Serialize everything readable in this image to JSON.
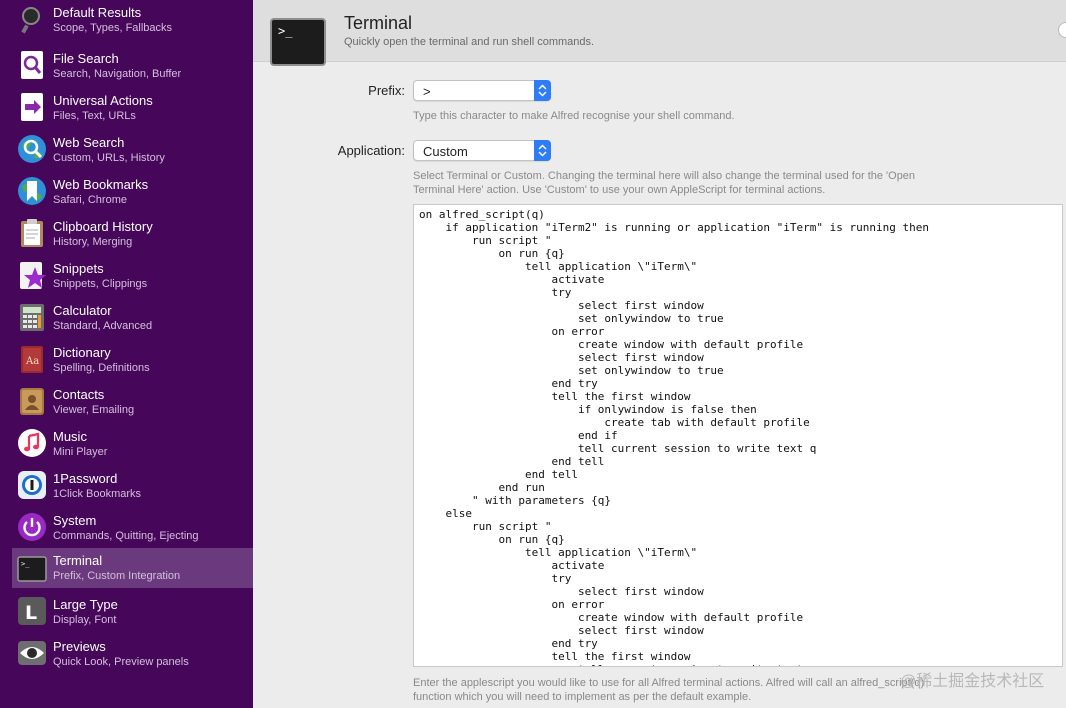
{
  "sidebar": {
    "items": [
      {
        "title": "Default Results",
        "subtitle": "Scope, Types, Fallbacks",
        "icon": "magnifier-default-icon",
        "selected": false
      },
      {
        "title": "File Search",
        "subtitle": "Search, Navigation, Buffer",
        "icon": "file-search-icon",
        "selected": false
      },
      {
        "title": "Universal Actions",
        "subtitle": "Files, Text, URLs",
        "icon": "universal-actions-icon",
        "selected": false
      },
      {
        "title": "Web Search",
        "subtitle": "Custom, URLs, History",
        "icon": "web-search-globe-icon",
        "selected": false
      },
      {
        "title": "Web Bookmarks",
        "subtitle": "Safari, Chrome",
        "icon": "bookmark-globe-icon",
        "selected": false
      },
      {
        "title": "Clipboard History",
        "subtitle": "History, Merging",
        "icon": "clipboard-icon",
        "selected": false
      },
      {
        "title": "Snippets",
        "subtitle": "Snippets, Clippings",
        "icon": "snippets-star-icon",
        "selected": false
      },
      {
        "title": "Calculator",
        "subtitle": "Standard, Advanced",
        "icon": "calculator-icon",
        "selected": false
      },
      {
        "title": "Dictionary",
        "subtitle": "Spelling, Definitions",
        "icon": "dictionary-icon",
        "selected": false
      },
      {
        "title": "Contacts",
        "subtitle": "Viewer, Emailing",
        "icon": "contacts-icon",
        "selected": false
      },
      {
        "title": "Music",
        "subtitle": "Mini Player",
        "icon": "music-note-icon",
        "selected": false
      },
      {
        "title": "1Password",
        "subtitle": "1Click Bookmarks",
        "icon": "onepassword-icon",
        "selected": false
      },
      {
        "title": "System",
        "subtitle": "Commands, Quitting, Ejecting",
        "icon": "power-icon",
        "selected": false
      },
      {
        "title": "Terminal",
        "subtitle": "Prefix, Custom Integration",
        "icon": "terminal-icon",
        "selected": true
      },
      {
        "title": "Large Type",
        "subtitle": "Display, Font",
        "icon": "large-type-icon",
        "selected": false
      },
      {
        "title": "Previews",
        "subtitle": "Quick Look, Preview panels",
        "icon": "eye-icon",
        "selected": false
      }
    ]
  },
  "header": {
    "title": "Terminal",
    "subtitle": "Quickly open the terminal and run shell commands.",
    "icon_glyph": ">_"
  },
  "form": {
    "prefix_label": "Prefix:",
    "prefix_value": ">",
    "prefix_hint": "Type this character to make Alfred recognise your shell command.",
    "application_label": "Application:",
    "application_value": "Custom",
    "application_hint_line1": "Select Terminal or Custom. Changing the terminal here will also change the terminal used for the 'Open",
    "application_hint_line2": "Terminal Here' action. Use 'Custom' to use your own AppleScript for terminal actions.",
    "script": "on alfred_script(q)\n    if application \"iTerm2\" is running or application \"iTerm\" is running then\n        run script \"\n            on run {q}\n                tell application \\\"iTerm\\\"\n                    activate\n                    try\n                        select first window\n                        set onlywindow to true\n                    on error\n                        create window with default profile\n                        select first window\n                        set onlywindow to true\n                    end try\n                    tell the first window\n                        if onlywindow is false then\n                            create tab with default profile\n                        end if\n                        tell current session to write text q\n                    end tell\n                end tell\n            end run\n        \" with parameters {q}\n    else\n        run script \"\n            on run {q}\n                tell application \\\"iTerm\\\"\n                    activate\n                    try\n                        select first window\n                    on error\n                        create window with default profile\n                        select first window\n                    end try\n                    tell the first window\n                        tell current session to write text q",
    "script_hint_line1": "Enter the applescript you would like to use for all Alfred terminal actions. Alfred will call an alfred_script(q)",
    "script_hint_line2": "function which you will need to implement as per the default example."
  },
  "watermark": "@稀土掘金技术社区",
  "colors": {
    "sidebar_bg": "#46075a",
    "selected_bg": "#6b3a7e",
    "accent": "#2e7cf6"
  }
}
